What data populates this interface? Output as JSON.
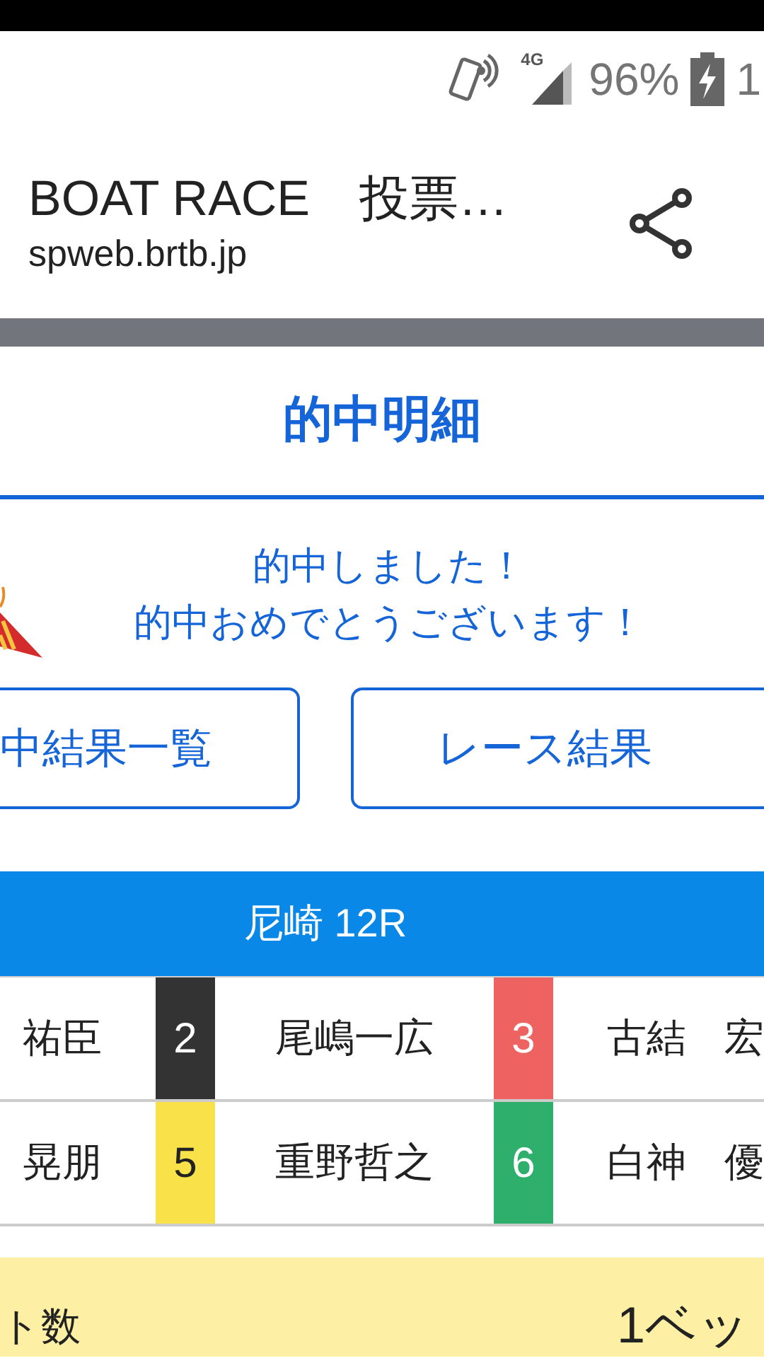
{
  "status_bar": {
    "network": "4G",
    "battery": "96%",
    "clock": "1"
  },
  "address_bar": {
    "title": "BOAT RACE　投票…",
    "url": "spweb.brtb.jp"
  },
  "panel": {
    "title": "的中明細"
  },
  "message": [
    "的中しました！",
    "的中おめでとうございます！"
  ],
  "buttons": [
    "中結果一覧",
    "レース結果"
  ],
  "race": {
    "title": "尼崎 12R",
    "rows": [
      [
        {
          "name": "祐臣"
        },
        {
          "boat": "2",
          "color": "#333333",
          "name": "尾嶋一広"
        },
        {
          "boat": "3",
          "color": "#ef6262",
          "name": "古結",
          "extra": "宏"
        }
      ],
      [
        {
          "name": "晃朋"
        },
        {
          "boat": "5",
          "color": "#f9e14a",
          "name": "重野哲之"
        },
        {
          "boat": "6",
          "color": "#2eb06c",
          "name": "白神",
          "extra": "優"
        }
      ]
    ]
  },
  "summary": {
    "label": "ト数",
    "value": "1ベッ"
  }
}
